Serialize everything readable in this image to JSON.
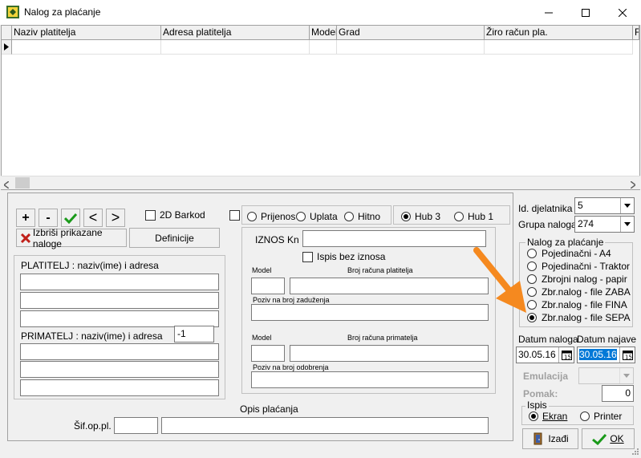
{
  "window": {
    "title": "Nalog za plaćanje"
  },
  "grid": {
    "columns": [
      "Naziv platitelja",
      "Adresa platitelja",
      "Model",
      "Grad",
      "Žiro račun pla.",
      "F"
    ]
  },
  "toolbar": {
    "add": "+",
    "remove": "-",
    "prev": "<",
    "next": ">",
    "delete_shown": "Izbriši prikazane naloge",
    "definitions": "Definicije",
    "barcode": "2D Barkod"
  },
  "payment_type": {
    "prijenos": "Prijenos",
    "uplata": "Uplata",
    "hitno": "Hitno",
    "hub3": "Hub 3",
    "hub1": "Hub 1"
  },
  "payer": {
    "label": "PLATITELJ : naziv(ime) i adresa"
  },
  "recipient": {
    "label": "PRIMATELJ : naziv(ime) i adresa",
    "id_value": "-1"
  },
  "amount": {
    "label": "IZNOS Kn",
    "no_amount": "Ispis bez iznosa",
    "model": "Model",
    "payer_account": "Broj računa platitelja",
    "debit_ref": "Poziv na broj zaduženja",
    "model2": "Model",
    "recipient_account": "Broj računa primatelja",
    "credit_ref": "Poziv na broj odobrenja"
  },
  "description": {
    "label": "Opis plaćanja",
    "code_label": "Šif.op.pl."
  },
  "side": {
    "id_label": "Id. djelatnika",
    "id_value": "5",
    "group_label": "Grupa naloga",
    "group_value": "274",
    "order_legend": "Nalog za plaćanje",
    "options": [
      "Pojedinačni - A4",
      "Pojedinačni - Traktor",
      "Zbrojni nalog - papir",
      "Zbr.nalog - file ZABA",
      "Zbr.nalog - file FINA",
      "Zbr.nalog - file SEPA"
    ],
    "date_order_label": "Datum naloga",
    "date_order_value": "30.05.16",
    "date_due_label": "Datum najave",
    "date_due_value": "30.05.16",
    "emulation_label": "Emulacija",
    "shift_label": "Pomak:",
    "shift_value": "0",
    "print_legend": "Ispis",
    "screen": "Ekran",
    "printer": "Printer",
    "exit": "Izađi",
    "ok": "OK"
  },
  "colors": {
    "accent_arrow": "#f5891f",
    "highlight": "#0078d7"
  }
}
